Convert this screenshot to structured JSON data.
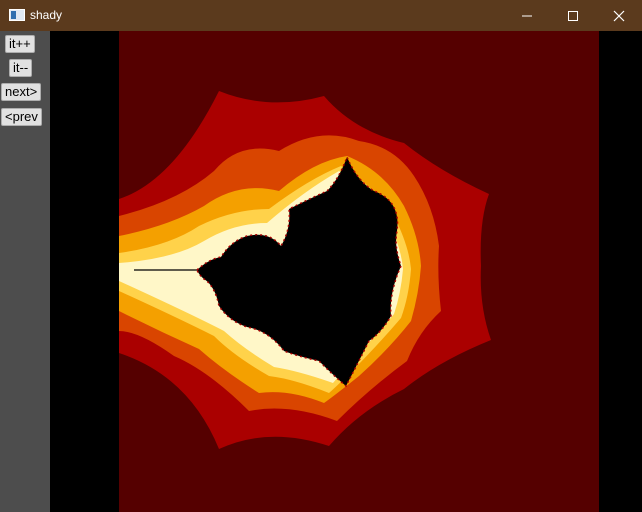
{
  "window": {
    "title": "shady",
    "icon": "app-window-icon",
    "controls": [
      "minimize-icon",
      "maximize-icon",
      "close-icon"
    ]
  },
  "toolbar": {
    "it_inc_label": "it++",
    "it_dec_label": "it--",
    "next_label": "next>",
    "prev_label": "<prev"
  },
  "colors": {
    "titlebar": "#5b3a1d",
    "sidebar": "#4d4d4d",
    "fractal_background": "#550000",
    "band_1": "#aa0000",
    "band_2": "#d94500",
    "band_3": "#f4a000",
    "band_4": "#ffd24a",
    "band_5": "#fff7c8",
    "set_interior": "#000000"
  }
}
